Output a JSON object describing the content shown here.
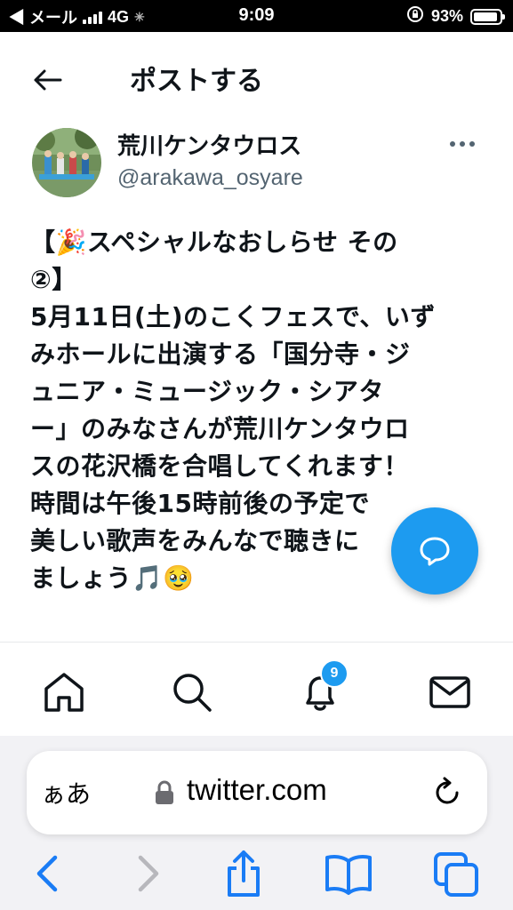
{
  "status": {
    "carrier": "◀ メール",
    "network": "4G",
    "time": "9:09",
    "battery": "93%"
  },
  "header": {
    "title": "ポストする"
  },
  "post": {
    "username": "荒川ケンタウロス",
    "handle": "@arakawa_osyare",
    "lines": [
      "【🎉スペシャルなおしらせ その",
      "②】",
      "5月11日(土)のこくフェスで、いず",
      "みホールに出演する「国分寺・ジ",
      "ュニア・ミュージック・シアタ",
      "ー」のみなさんが荒川ケンタウロ",
      "スの花沢橋を合唱してくれます！",
      "時間は午後15時前後の予定で",
      "美しい歌声をみんなで聴きに",
      "ましょう🎵🥹"
    ]
  },
  "nav": {
    "items": [
      "home-icon",
      "search-icon",
      "notifications-icon",
      "messages-icon"
    ],
    "notification_count": "9"
  },
  "safari": {
    "aa_label": "ぁあ",
    "url": "twitter.com"
  },
  "colors": {
    "accent": "#1d9bf0",
    "text": "#0f1419",
    "secondary": "#536471",
    "safari_blue": "#1a7cf5"
  }
}
